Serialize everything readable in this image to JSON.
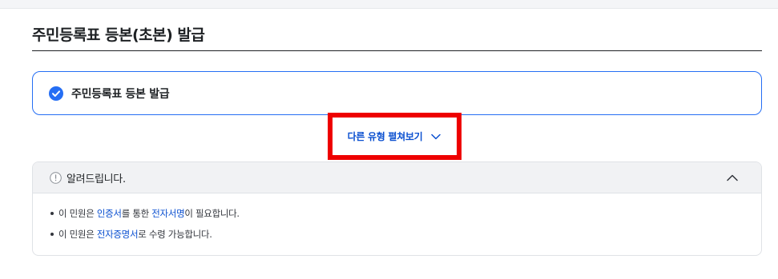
{
  "header": {
    "title": "주민등록표 등본(초본) 발급"
  },
  "option": {
    "label": "주민등록표 등본 발급",
    "icon": "check-circle-icon",
    "accent": "#256ef4"
  },
  "expand": {
    "label": "다른 유형 펼쳐보기",
    "icon": "chevron-down-icon",
    "highlight_color": "#ee0000"
  },
  "notice": {
    "title": "알려드립니다.",
    "icon": "info-icon",
    "toggle_icon": "chevron-up-icon",
    "lines": [
      {
        "t1": "이 민원은 ",
        "h1": "인증서",
        "t2": "를 통한 ",
        "h2": "전자서명",
        "t3": "이 필요합니다."
      },
      {
        "t1": "이 민원은 ",
        "h1": "전자증명서",
        "t2": "로 수령 가능합니다."
      }
    ]
  }
}
